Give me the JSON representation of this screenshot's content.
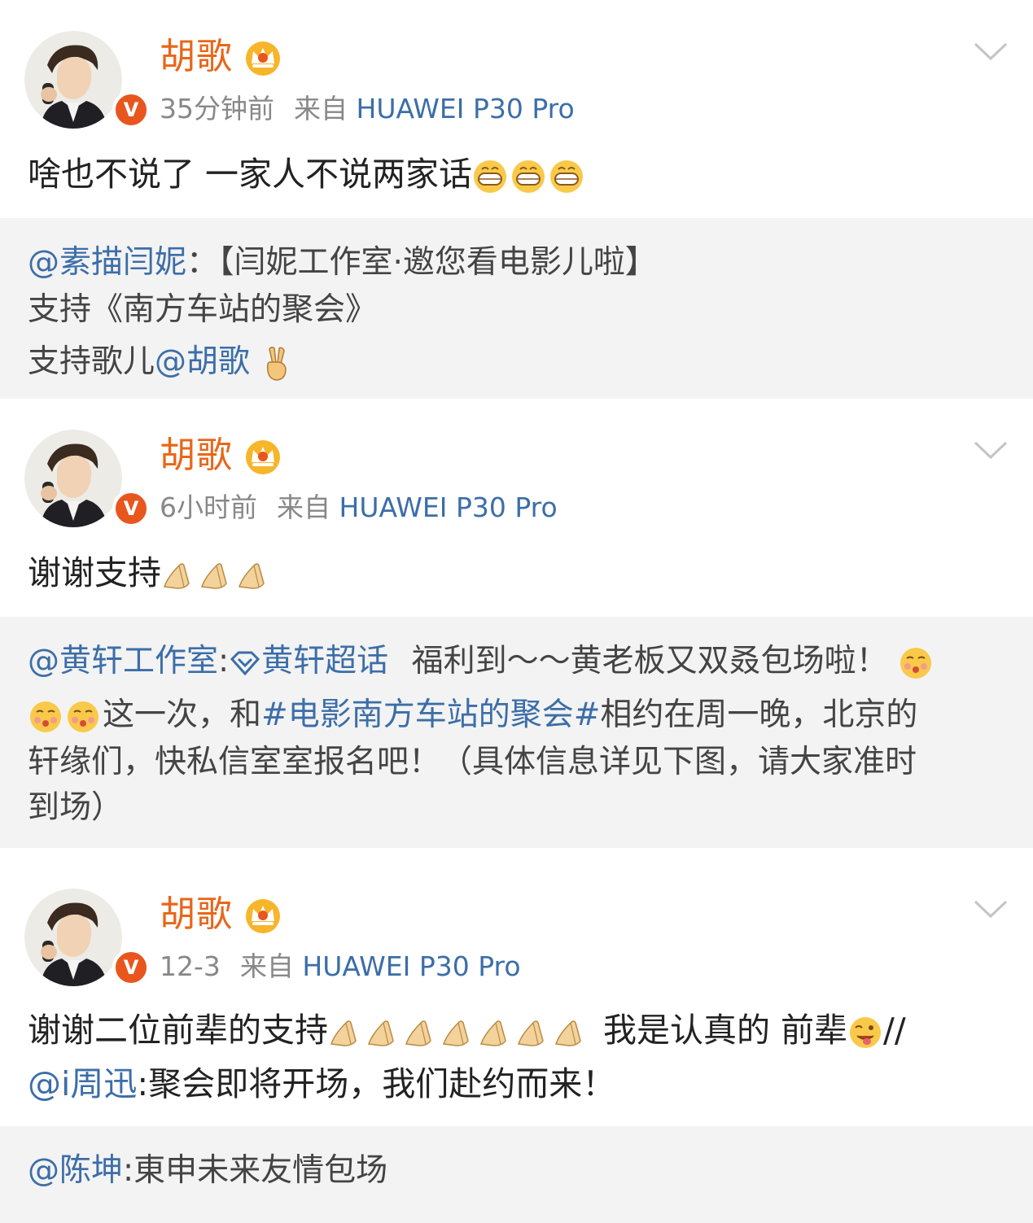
{
  "posts": [
    {
      "author": "胡歌",
      "time": "35分钟前",
      "source_prefix": "来自",
      "source": "HUAWEI P30 Pro",
      "text": "啥也不说了 一家人不说两家话",
      "text_emoji": [
        "grin-emoji",
        "grin-emoji",
        "grin-emoji"
      ],
      "repost": {
        "lines": [
          {
            "mention": "@素描闫妮",
            "sep": "：",
            "text": "【闫妮工作室·邀您看电影儿啦】"
          },
          {
            "text": "支持《南方车站的聚会》"
          },
          {
            "text": "支持歌儿",
            "mention": "@胡歌",
            "emoji": "victory-hand-emoji"
          }
        ]
      }
    },
    {
      "author": "胡歌",
      "time": "6小时前",
      "source_prefix": "来自",
      "source": "HUAWEI P30 Pro",
      "text": "谢谢支持",
      "text_emoji": [
        "bow-hands-emoji",
        "bow-hands-emoji",
        "bow-hands-emoji"
      ],
      "repost": {
        "lines": [
          {
            "mention": "@黄轩工作室",
            "sep": ":",
            "topic": "黄轩超话",
            "text": "福利到～～黄老板又双叒包场啦！"
          },
          {
            "text": "这一次，和",
            "hashtag": "#电影南方车站的聚会#",
            "text2": "相约在周一晚，北京的"
          },
          {
            "text": "轩缘们，快私信室室报名吧！（具体信息详见下图，请大家准时"
          },
          {
            "text": "到场）"
          }
        ]
      }
    },
    {
      "author": "胡歌",
      "time": "12-3",
      "source_prefix": "来自",
      "source": "HUAWEI P30 Pro",
      "line1_a": "谢谢二位前辈的支持",
      "line1_b": "我是认真的 前辈",
      "line1_c": "//",
      "line2_mention": "@i周迅",
      "line2_text": ":聚会即将开场，我们赴约而来！",
      "repost": {
        "lines": [
          {
            "mention": "@陈坤",
            "sep": ":",
            "text": "東申未来友情包场"
          }
        ]
      }
    }
  ],
  "colors": {
    "author": "#e8661a",
    "link": "#3c6ea8",
    "meta": "#888888",
    "repost_bg": "#f3f3f3",
    "vip_badge": "#e8561e"
  }
}
